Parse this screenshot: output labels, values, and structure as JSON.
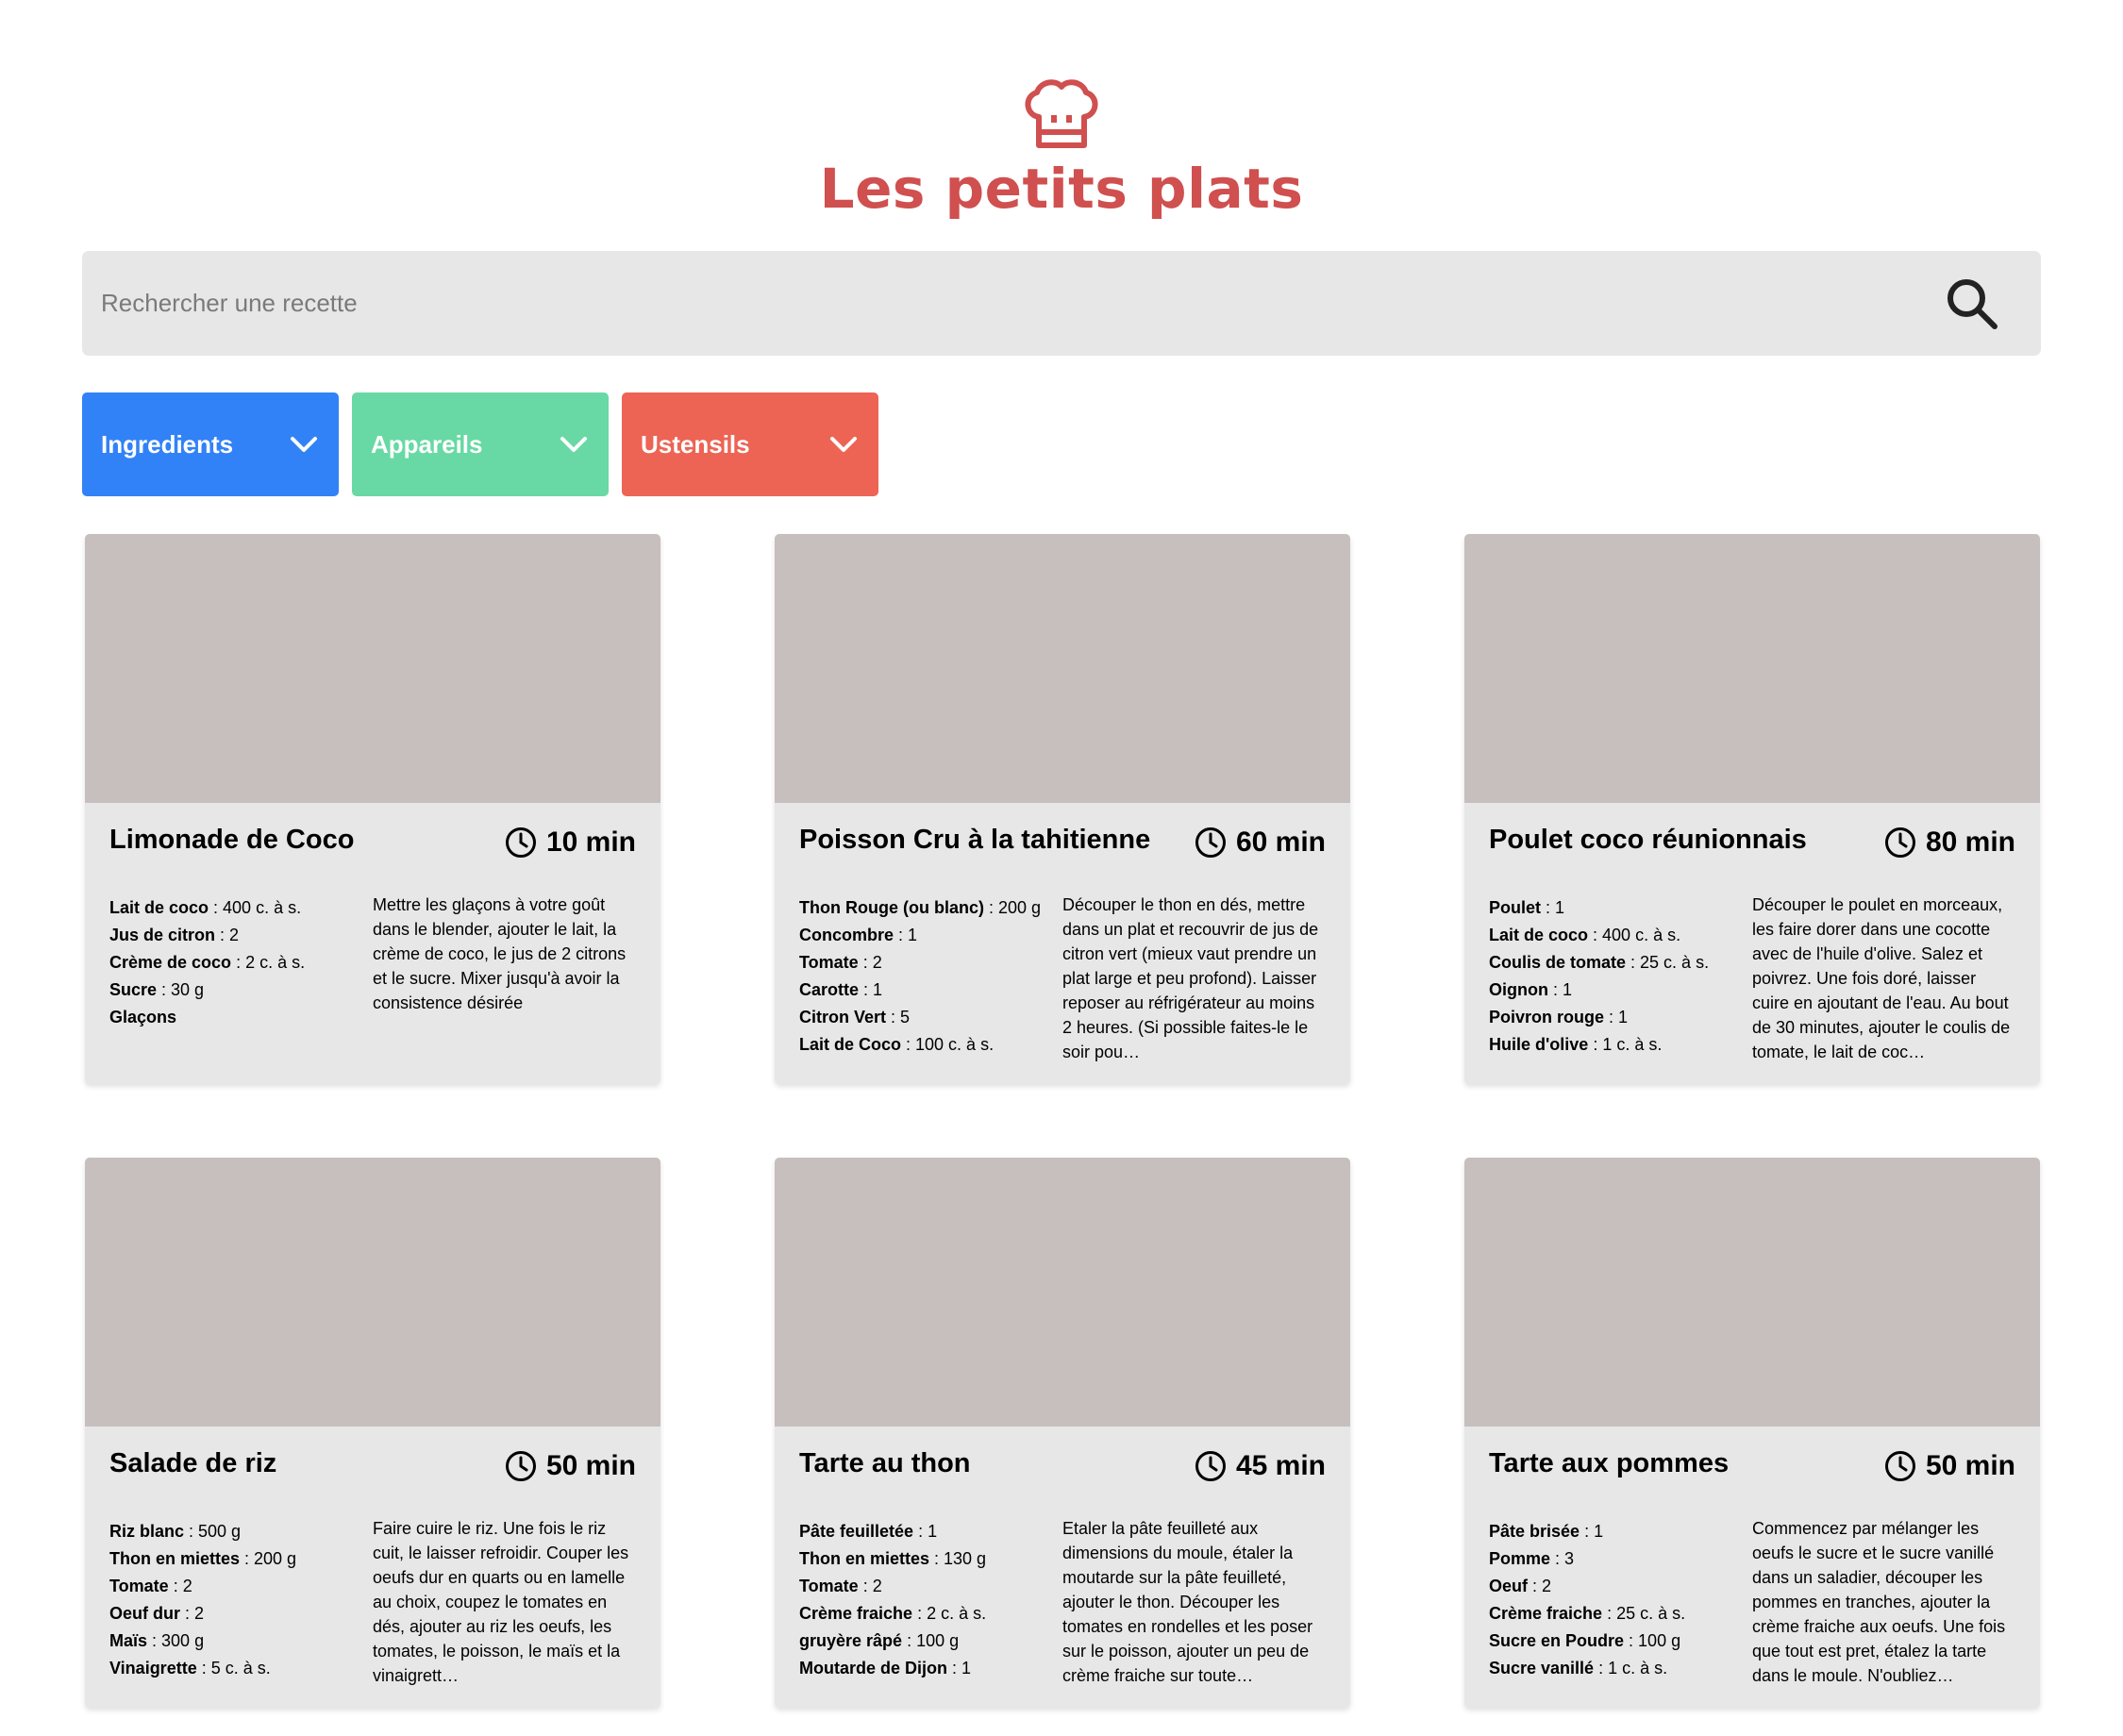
{
  "header": {
    "title": "Les petits plats",
    "logo_icon": "chef-hat-icon",
    "brand_color": "#D04F4F"
  },
  "search": {
    "placeholder": "Rechercher une recette",
    "value": "",
    "icon": "search-icon"
  },
  "filters": [
    {
      "label": "Ingredients",
      "color": "#3282F7"
    },
    {
      "label": "Appareils",
      "color": "#68D9A4"
    },
    {
      "label": "Ustensils",
      "color": "#ED6454"
    }
  ],
  "recipes": [
    {
      "name": "Limonade de Coco",
      "time": "10 min",
      "ingredients": [
        {
          "name": "Lait de coco",
          "qty": " : 400  c. à s."
        },
        {
          "name": "Jus de citron",
          "qty": " : 2"
        },
        {
          "name": "Crème de coco",
          "qty": " : 2  c. à s."
        },
        {
          "name": "Sucre",
          "qty": " : 30 g"
        },
        {
          "name": "Glaçons",
          "qty": ""
        }
      ],
      "description": "Mettre les glaçons à votre goût dans le blender, ajouter le lait, la crème de coco, le jus de 2 citrons et le sucre. Mixer jusqu'à avoir la consistence désirée"
    },
    {
      "name": "Poisson Cru à la tahitienne",
      "time": "60 min",
      "ingredients": [
        {
          "name": "Thon Rouge (ou blanc)",
          "qty": " : 200 g"
        },
        {
          "name": "Concombre",
          "qty": " : 1"
        },
        {
          "name": "Tomate",
          "qty": " : 2"
        },
        {
          "name": "Carotte",
          "qty": " : 1"
        },
        {
          "name": "Citron Vert",
          "qty": " : 5"
        },
        {
          "name": "Lait de Coco",
          "qty": " : 100  c. à s."
        }
      ],
      "description": "Découper le thon en dés, mettre dans un plat et recouvrir de jus de citron vert (mieux vaut prendre un plat large et peu profond). Laisser reposer au réfrigérateur au moins 2 heures. (Si possible faites-le le soir pou…"
    },
    {
      "name": "Poulet coco réunionnais",
      "time": "80 min",
      "ingredients": [
        {
          "name": "Poulet",
          "qty": " : 1"
        },
        {
          "name": "Lait de coco",
          "qty": " : 400  c. à s."
        },
        {
          "name": "Coulis de tomate",
          "qty": " : 25  c. à s."
        },
        {
          "name": "Oignon",
          "qty": " : 1"
        },
        {
          "name": "Poivron rouge",
          "qty": " : 1"
        },
        {
          "name": "Huile d'olive",
          "qty": " : 1  c. à s."
        }
      ],
      "description": "Découper le poulet en morceaux, les faire dorer dans une cocotte avec de l'huile d'olive. Salez et poivrez. Une fois doré, laisser cuire en ajoutant de l'eau. Au bout de 30 minutes, ajouter le coulis de tomate, le lait de coc…"
    },
    {
      "name": "Salade de riz",
      "time": "50 min",
      "ingredients": [
        {
          "name": "Riz blanc",
          "qty": " : 500 g"
        },
        {
          "name": "Thon en miettes",
          "qty": " : 200 g"
        },
        {
          "name": "Tomate",
          "qty": " : 2"
        },
        {
          "name": "Oeuf dur",
          "qty": " : 2"
        },
        {
          "name": "Maïs",
          "qty": " : 300 g"
        },
        {
          "name": "Vinaigrette",
          "qty": " : 5  c. à s."
        }
      ],
      "description": "Faire cuire le riz. Une fois le riz cuit, le laisser refroidir. Couper les oeufs dur en quarts ou en lamelle au choix, coupez le tomates en dés, ajouter au riz les oeufs, les tomates, le poisson, le maïs et la vinaigrett…"
    },
    {
      "name": "Tarte au thon",
      "time": "45 min",
      "ingredients": [
        {
          "name": "Pâte feuilletée",
          "qty": " : 1"
        },
        {
          "name": "Thon en miettes",
          "qty": " : 130 g"
        },
        {
          "name": "Tomate",
          "qty": " : 2"
        },
        {
          "name": "Crème fraiche",
          "qty": " : 2  c. à s."
        },
        {
          "name": "gruyère râpé",
          "qty": " : 100 g"
        },
        {
          "name": "Moutarde de Dijon",
          "qty": " : 1"
        }
      ],
      "description": "Etaler la pâte feuilleté aux dimensions du moule, étaler la moutarde sur la pâte feuilleté, ajouter le thon. Découper les tomates en rondelles et les poser sur le poisson, ajouter un peu de crème fraiche sur toute…"
    },
    {
      "name": "Tarte aux pommes",
      "time": "50 min",
      "ingredients": [
        {
          "name": "Pâte brisée",
          "qty": " : 1"
        },
        {
          "name": "Pomme",
          "qty": " : 3"
        },
        {
          "name": "Oeuf",
          "qty": " : 2"
        },
        {
          "name": "Crème fraiche",
          "qty": " : 25  c. à s."
        },
        {
          "name": "Sucre en Poudre",
          "qty": " : 100 g"
        },
        {
          "name": "Sucre vanillé",
          "qty": " : 1  c. à s."
        }
      ],
      "description": "Commencez par mélanger les oeufs le sucre et le sucre vanillé dans un saladier, découper les pommes en tranches, ajouter la crème fraiche aux oeufs. Une fois que tout est pret, étalez la tarte dans le moule. N'oubliez…"
    }
  ]
}
